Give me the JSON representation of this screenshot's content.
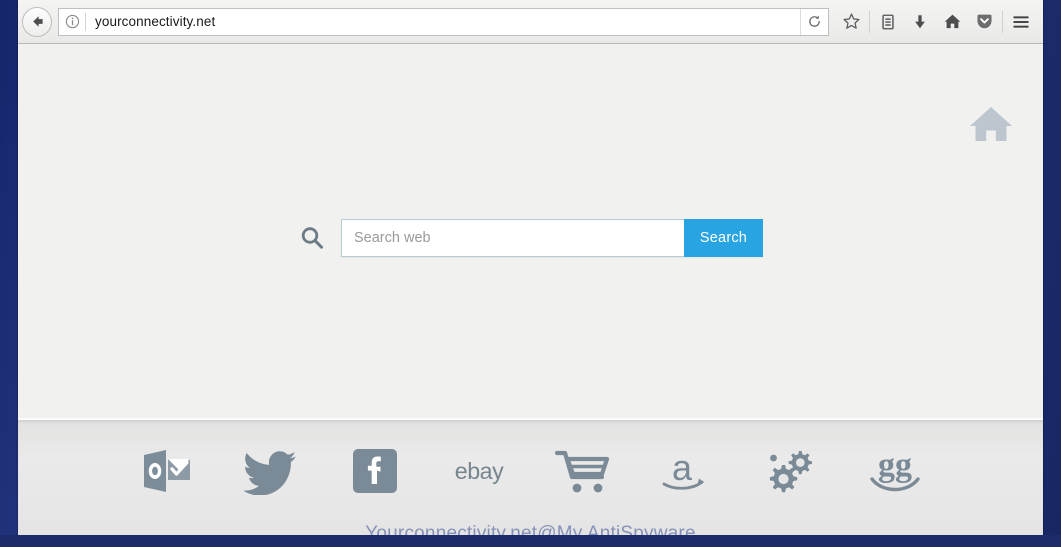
{
  "desktop": {
    "background_color": "#1f3173"
  },
  "browser": {
    "toolbar": {
      "back_button": "back-arrow",
      "info_icon": "info-icon",
      "url": "yourconnectivity.net",
      "reload_icon": "reload-icon",
      "icons": [
        {
          "name": "bookmark-star-icon",
          "label": "Bookmark"
        },
        {
          "name": "library-icon",
          "label": "Library"
        },
        {
          "name": "downloads-icon",
          "label": "Downloads"
        },
        {
          "name": "home-icon",
          "label": "Home"
        },
        {
          "name": "pocket-icon",
          "label": "Pocket"
        },
        {
          "name": "menu-icon",
          "label": "Open menu"
        }
      ]
    }
  },
  "page": {
    "home_icon_label": "Home",
    "search": {
      "placeholder": "Search web",
      "value": "",
      "button_label": "Search",
      "button_color": "#28a4e2",
      "magnifier_icon": "search-icon"
    },
    "shortcuts": [
      {
        "name": "outlook",
        "label": "Outlook"
      },
      {
        "name": "twitter",
        "label": "Twitter"
      },
      {
        "name": "facebook",
        "label": "Facebook"
      },
      {
        "name": "ebay",
        "label": "eBay"
      },
      {
        "name": "cart",
        "label": "Shopping"
      },
      {
        "name": "amazon",
        "label": "Amazon"
      },
      {
        "name": "settings",
        "label": "Settings"
      },
      {
        "name": "gumtree",
        "label": "Gumtree"
      }
    ],
    "watermark": "Yourconnectivity.net@My AntiSpyware"
  }
}
